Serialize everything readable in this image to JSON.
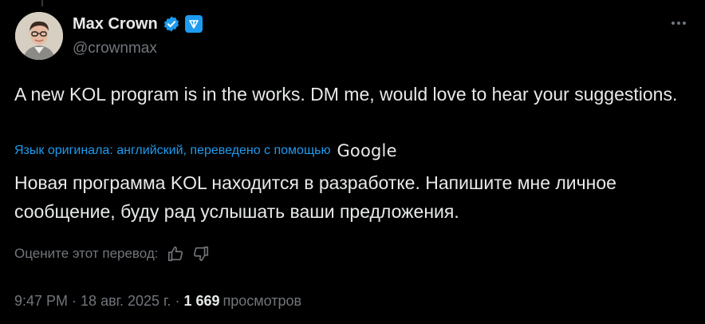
{
  "author": {
    "display_name": "Max Crown",
    "handle": "@crownmax",
    "verified": true
  },
  "tweet": {
    "text": "A new KOL program is in the works. DM me, would love to hear your suggestions.",
    "translation_note": "Язык оригинала: английский, переведено с помощью",
    "translation_provider": "Google",
    "translated_text": "Новая программа KOL находится в разработке. Напишите мне личное сообщение, буду рад услышать ваши предложения.",
    "rate_label": "Оцените этот перевод:"
  },
  "meta": {
    "time": "9:47 PM",
    "separator": "·",
    "date": "18 авг. 2025 г.",
    "views_count": "1 669",
    "views_label": "просмотров"
  },
  "icons": {
    "more": "more-icon",
    "verified": "verified-badge-icon",
    "affiliate": "ton-badge-icon",
    "thumbs_up": "thumbs-up-icon",
    "thumbs_down": "thumbs-down-icon"
  },
  "colors": {
    "background": "#000000",
    "text": "#e7e9ea",
    "muted": "#71767b",
    "link": "#1d9bf0"
  }
}
